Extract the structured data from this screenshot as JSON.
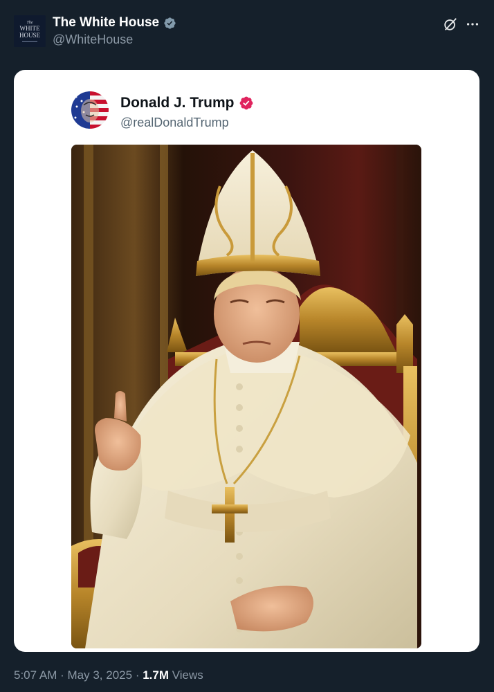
{
  "post": {
    "author": {
      "display_name": "The White House",
      "handle": "@WhiteHouse",
      "verified": "gray-check",
      "avatar_lines": {
        "the": "The",
        "white": "WHITE",
        "house": "HOUSE"
      }
    },
    "actions": {
      "grok_icon": "grok-icon",
      "more_icon": "more-icon"
    },
    "embedded_post": {
      "display_name": "Donald J. Trump",
      "handle": "@realDonaldTrump",
      "verified": "pink-check",
      "image_description": "AI-generated image of Donald Trump dressed as the Pope, seated on a gold throne"
    },
    "meta": {
      "time": "5:07 AM",
      "separator": "·",
      "date": "May 3, 2025",
      "views_count": "1.7M",
      "views_label": "Views"
    }
  },
  "colors": {
    "background": "#15202b",
    "card": "#ffffff",
    "gray_check": "#829aab",
    "pink_check": "#e0245e",
    "muted_text": "#8b98a5"
  }
}
